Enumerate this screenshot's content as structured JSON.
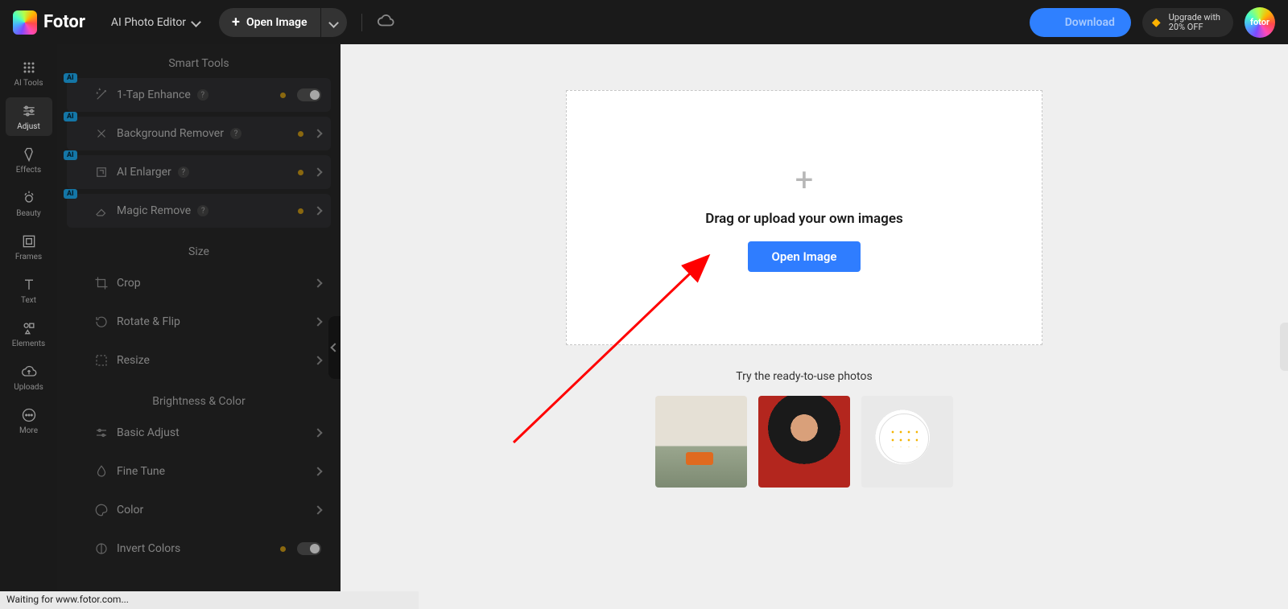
{
  "header": {
    "logo_text": "Fotor",
    "app_mode": "AI Photo Editor",
    "open_image": "Open Image",
    "download": "Download",
    "upgrade_line1": "Upgrade with",
    "upgrade_line2": "20% OFF",
    "avatar_label": "fotor"
  },
  "rail": {
    "ai_tools": "AI Tools",
    "adjust": "Adjust",
    "effects": "Effects",
    "beauty": "Beauty",
    "frames": "Frames",
    "text": "Text",
    "elements": "Elements",
    "uploads": "Uploads",
    "more": "More"
  },
  "panel": {
    "smart_tools_title": "Smart Tools",
    "tools": {
      "enhance": "1-Tap Enhance",
      "bg_remover": "Background Remover",
      "enlarger": "AI Enlarger",
      "magic_remove": "Magic Remove"
    },
    "size_title": "Size",
    "size": {
      "crop": "Crop",
      "rotate": "Rotate & Flip",
      "resize": "Resize"
    },
    "bc_title": "Brightness & Color",
    "bc": {
      "basic": "Basic Adjust",
      "fine": "Fine Tune",
      "color": "Color",
      "invert": "Invert Colors"
    },
    "ai_badge": "AI"
  },
  "canvas": {
    "drop_text": "Drag or upload your own images",
    "open_btn": "Open Image",
    "try_title": "Try the ready-to-use photos"
  },
  "status": "Waiting for www.fotor.com..."
}
